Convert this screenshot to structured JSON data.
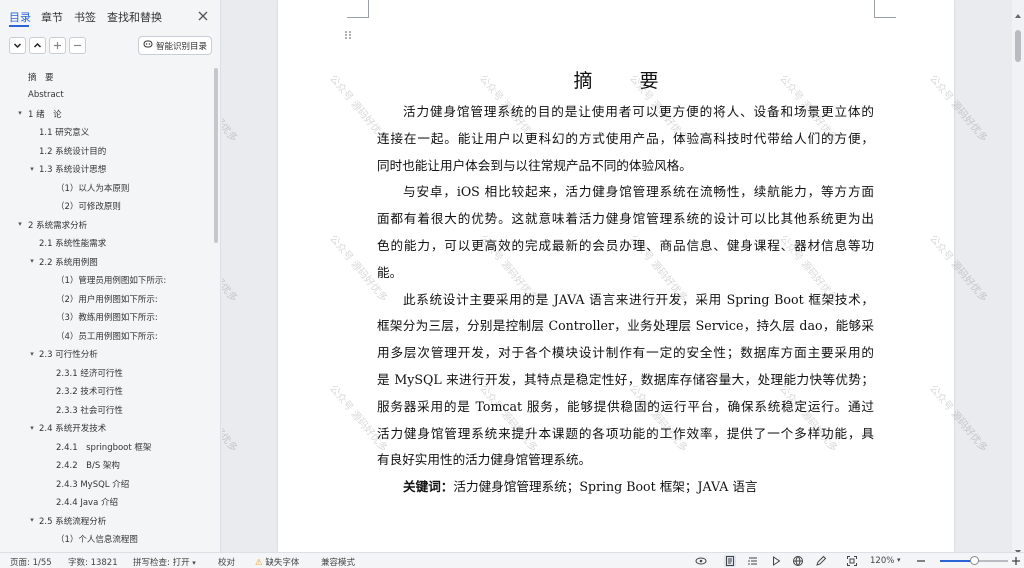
{
  "nav": {
    "tabs": [
      {
        "label": "目录",
        "active": true
      },
      {
        "label": "章节",
        "active": false
      },
      {
        "label": "书签",
        "active": false
      },
      {
        "label": "查找和替换",
        "active": false
      }
    ],
    "smart_toc_label": "智能识别目录",
    "toc": [
      {
        "label": "摘　要",
        "level": 0,
        "caret": false
      },
      {
        "label": "Abstract",
        "level": 0,
        "caret": false
      },
      {
        "label": "1  绪　论",
        "level": 0,
        "caret": true
      },
      {
        "label": "1.1 研究意义",
        "level": 1,
        "caret": false
      },
      {
        "label": "1.2 系统设计目的",
        "level": 1,
        "caret": false
      },
      {
        "label": "1.3 系统设计思想",
        "level": 1,
        "caret": true
      },
      {
        "label": "（1）以人为本原则",
        "level": 2,
        "caret": false
      },
      {
        "label": "（2）可修改原则",
        "level": 2,
        "caret": false
      },
      {
        "label": "2 系统需求分析",
        "level": 0,
        "caret": true
      },
      {
        "label": "2.1 系统性能需求",
        "level": 1,
        "caret": false
      },
      {
        "label": "2.2 系统用例图",
        "level": 1,
        "caret": true
      },
      {
        "label": "（1）管理员用例图如下所示:",
        "level": 2,
        "caret": false
      },
      {
        "label": "（2）用户用例图如下所示:",
        "level": 2,
        "caret": false
      },
      {
        "label": "（3）教练用例图如下所示:",
        "level": 2,
        "caret": false
      },
      {
        "label": "（4）员工用例图如下所示:",
        "level": 2,
        "caret": false
      },
      {
        "label": "2.3 可行性分析",
        "level": 1,
        "caret": true
      },
      {
        "label": "2.3.1 经济可行性",
        "level": 2,
        "caret": false
      },
      {
        "label": "2.3.2 技术可行性",
        "level": 2,
        "caret": false
      },
      {
        "label": "2.3.3 社会可行性",
        "level": 2,
        "caret": false
      },
      {
        "label": "2.4 系统开发技术",
        "level": 1,
        "caret": true
      },
      {
        "label": "2.4.1　springboot 框架",
        "level": 2,
        "caret": false
      },
      {
        "label": "2.4.2　B/S 架构",
        "level": 2,
        "caret": false
      },
      {
        "label": "2.4.3 MySQL 介绍",
        "level": 2,
        "caret": false
      },
      {
        "label": "2.4.4 Java 介绍",
        "level": 2,
        "caret": false
      },
      {
        "label": "2.5 系统流程分析",
        "level": 1,
        "caret": true
      },
      {
        "label": "（1）个人信息流程图",
        "level": 2,
        "caret": false
      }
    ]
  },
  "document": {
    "title": "摘　要",
    "lines": [
      {
        "text": "活力健身馆管理系统的目的是让使用者可以更方便的将人、设备和场景更立体的",
        "indent": true,
        "justify": true
      },
      {
        "text": "连接在一起。能让用户以更科幻的方式使用产品，体验高科技时代带给人们的方便，",
        "indent": false,
        "justify": true
      },
      {
        "text": "同时也能让用户体会到与以往常规产品不同的体验风格。",
        "indent": false,
        "justify": false
      },
      {
        "text": "与安卓，iOS 相比较起来，活力健身馆管理系统在流畅性，续航能力，等方方面",
        "indent": true,
        "justify": true
      },
      {
        "text": "面都有着很大的优势。这就意味着活力健身馆管理系统的设计可以比其他系统更为出",
        "indent": false,
        "justify": true
      },
      {
        "text": "色的能力，可以更高效的完成最新的会员办理、商品信息、健身课程、器材信息等功",
        "indent": false,
        "justify": true
      },
      {
        "text": "能。",
        "indent": false,
        "justify": false
      },
      {
        "text": "此系统设计主要采用的是 JAVA 语言来进行开发，采用 Spring Boot 框架技术，",
        "indent": true,
        "justify": true
      },
      {
        "text": "框架分为三层，分别是控制层 Controller，业务处理层 Service，持久层 dao，能够采",
        "indent": false,
        "justify": true
      },
      {
        "text": "用多层次管理开发，对于各个模块设计制作有一定的安全性；数据库方面主要采用的",
        "indent": false,
        "justify": true
      },
      {
        "text": "是 MySQL 来进行开发，其特点是稳定性好，数据库存储容量大，处理能力快等优势；",
        "indent": false,
        "justify": true
      },
      {
        "text": "服务器采用的是 Tomcat 服务，能够提供稳固的运行平台，确保系统稳定运行。通过",
        "indent": false,
        "justify": true
      },
      {
        "text": "活力健身馆管理系统来提升本课题的各项功能的工作效率，提供了一个多样功能，具",
        "indent": false,
        "justify": true
      },
      {
        "text": "有良好实用性的活力健身馆管理系统。",
        "indent": false,
        "justify": false
      }
    ],
    "keywords_label": "关键词：",
    "keywords_text": "活力健身馆管理系统；Spring Boot 框架；JAVA 语言",
    "watermark": "公众号 源码好优多"
  },
  "status": {
    "page": "页面: 1/55",
    "words": "字数: 13821",
    "spellcheck": "拼写检查: 打开",
    "proofread": "校对",
    "missing_font": "缺失字体",
    "compat": "兼容模式",
    "zoom": "120%",
    "zoom_fraction": 0.5
  },
  "colors": {
    "accent": "#2a64d6",
    "warning": "#f0a020"
  }
}
